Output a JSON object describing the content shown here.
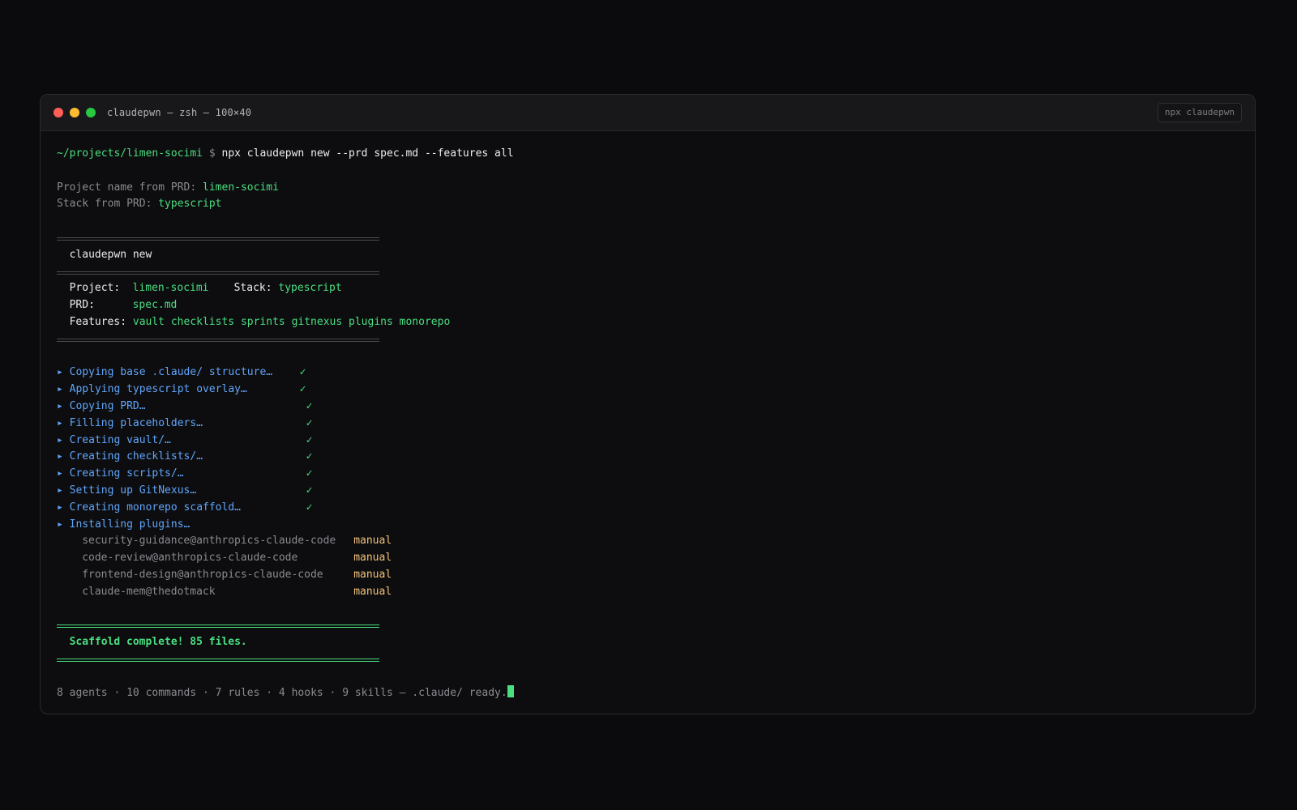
{
  "window": {
    "title": "claudepwn — zsh — 100×40",
    "badge": "npx claudepwn"
  },
  "prompt": {
    "path": "~/projects/limen-socimi",
    "symbol": "$",
    "command": "npx claudepwn new --prd spec.md --features all"
  },
  "detected": {
    "name_label": "Project name from PRD:",
    "name_value": "limen-socimi",
    "stack_label": "Stack from PRD:",
    "stack_value": "typescript"
  },
  "header": {
    "title": "claudepwn new",
    "project_label": "Project:",
    "project_value": "limen-socimi",
    "stack_label": "Stack:",
    "stack_value": "typescript",
    "prd_label": "PRD:",
    "prd_value": "spec.md",
    "features_label": "Features:",
    "features": [
      "vault",
      "checklists",
      "sprints",
      "gitnexus",
      "plugins",
      "monorepo"
    ]
  },
  "steps": [
    {
      "label": "Copying base .claude/ structure…",
      "status": "✓"
    },
    {
      "label": "Applying typescript overlay…",
      "status": "✓"
    },
    {
      "label": "Copying PRD…",
      "status": "✓"
    },
    {
      "label": "Filling placeholders…",
      "status": "✓"
    },
    {
      "label": "Creating vault/…",
      "status": "✓"
    },
    {
      "label": "Creating checklists/…",
      "status": "✓"
    },
    {
      "label": "Creating scripts/…",
      "status": "✓"
    },
    {
      "label": "Setting up GitNexus…",
      "status": "✓"
    },
    {
      "label": "Creating monorepo scaffold…",
      "status": "✓"
    },
    {
      "label": "Installing plugins…",
      "status": ""
    }
  ],
  "step_marker": "▸",
  "plugins": [
    {
      "name": "security-guidance@anthropics-claude-code",
      "status": "manual"
    },
    {
      "name": "code-review@anthropics-claude-code",
      "status": "manual"
    },
    {
      "name": "frontend-design@anthropics-claude-code",
      "status": "manual"
    },
    {
      "name": "claude-mem@thedotmack",
      "status": "manual"
    }
  ],
  "complete": {
    "message": "Scaffold complete! 85 files."
  },
  "summary": "8 agents · 10 commands · 7 rules · 4 hooks · 9 skills — .claude/ ready.",
  "colors": {
    "green": "#4ade80",
    "blue": "#60a5fa",
    "amber": "#f0c27b",
    "muted": "#8a8a90"
  }
}
